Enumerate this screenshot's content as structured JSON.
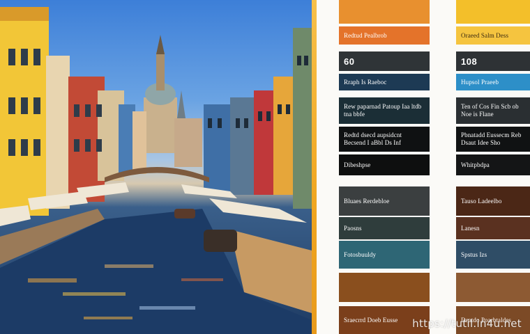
{
  "photo": {
    "scene": "canal city street with colorful buildings and domed church"
  },
  "swatches_left": [
    {
      "label": "",
      "color": "#e8902f"
    },
    {
      "label": "Redtud Pealbrob",
      "color": "#e4732a"
    },
    {
      "label": "60",
      "color": "#2f3437",
      "big": true
    },
    {
      "label": "Rraph Is Raeboc",
      "color": "#1d3a54"
    },
    {
      "label": "Rew paparnad Patoup Iaa ltdb tna bbfe",
      "color": "#1b2e36"
    },
    {
      "label": "Redtd dsecd aupsidcnt Becsend I aBbl Ds Inf",
      "color": "#0f1112"
    },
    {
      "label": "Dibeshpse",
      "color": "#0e0f0f"
    },
    {
      "label": "Bluaes Rerdebloe",
      "color": "#3b3f40"
    },
    {
      "label": "Paosns",
      "color": "#2f3d3c"
    },
    {
      "label": "Fotosbuuldy",
      "color": "#2e6675"
    },
    {
      "label": "",
      "color": "#8a4f1e"
    },
    {
      "label": "Sraecrrd Doeb Eusse",
      "color": "#7b3f1b"
    }
  ],
  "swatches_right": [
    {
      "label": "",
      "color": "#f3bf2a"
    },
    {
      "label": "Oraeed Salm Dess",
      "color": "#f5c43f",
      "light": true
    },
    {
      "label": "108",
      "color": "#2e3235",
      "big": true
    },
    {
      "label": "Hupsol Praeeb",
      "color": "#2d8fc8"
    },
    {
      "label": "Ten of Cos Fin Scb ob Noe is Flane",
      "color": "#2a2f32"
    },
    {
      "label": "Pbnatadd Eussecm Reb Dsaut Idee Sho",
      "color": "#101213"
    },
    {
      "label": "Whitpbdpa",
      "color": "#141516"
    },
    {
      "label": "Tauso Ladeelbo",
      "color": "#4b2716"
    },
    {
      "label": "Lanesn",
      "color": "#5a3120"
    },
    {
      "label": "Spstus Izs",
      "color": "#2f4d66"
    },
    {
      "label": "",
      "color": "#8d5a33"
    },
    {
      "label": "Deatdo Poarbtaldes",
      "color": "#7c4a26"
    }
  ],
  "watermark": "https://tutil.in4u.net"
}
